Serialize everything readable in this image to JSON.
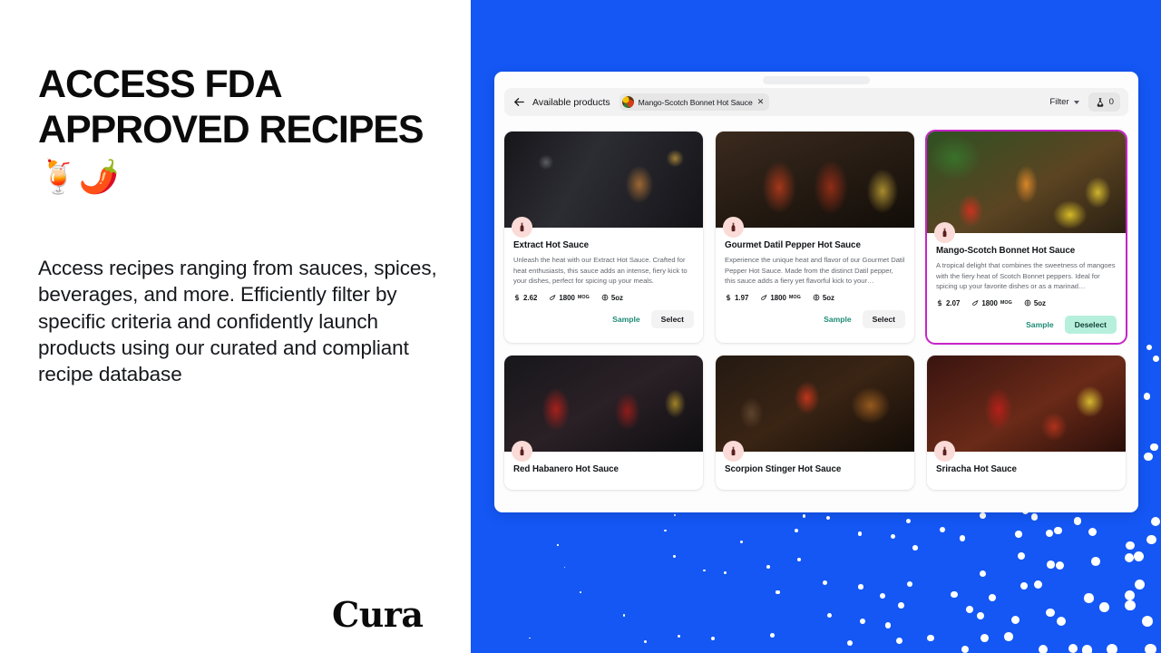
{
  "slide": {
    "headline": "ACCESS FDA APPROVED RECIPES",
    "headline_emojis": "🍹🌶️",
    "subcopy": "Access recipes ranging from sauces, spices, beverages, and more. Efficiently filter by specific criteria and confidently launch products using our curated and compliant recipe database",
    "brand": "Cura",
    "accent_blue": "#1457f5",
    "accent_magenta": "#c724c7",
    "accent_teal": "#1e8b76",
    "badge_pink": "#fadbd7"
  },
  "app": {
    "toolbar": {
      "back_icon": "arrow-left-icon",
      "title": "Available products",
      "chip": {
        "label": "Mango-Scotch Bonnet Hot Sauce",
        "close": "✕",
        "avatar_icon": "product-thumbnail"
      },
      "filter_label": "Filter",
      "count_value": "0",
      "count_icon": "flask-icon"
    },
    "labels": {
      "sample": "Sample",
      "select": "Select",
      "deselect": "Deselect",
      "price_icon": "dollar-icon",
      "heat_icon": "pepper-heat-icon",
      "size_icon": "volume-icon"
    },
    "products": [
      {
        "title": "Extract Hot Sauce",
        "description": "Unleash the heat with our Extract Hot Sauce. Crafted for heat enthusiasts, this sauce adds an intense, fiery kick to your dishes, perfect for spicing up your meals.",
        "price": "2.62",
        "heat": "1800",
        "heat_unit": "MOG",
        "size": "5oz",
        "action": "Select",
        "selected": false,
        "photo": "photo-extract"
      },
      {
        "title": "Gourmet Datil Pepper Hot Sauce",
        "description": "Experience the unique heat and flavor of our Gourmet Datil Pepper Hot Sauce. Made from the distinct Datil pepper, this sauce adds a fiery yet flavorful kick to your…",
        "price": "1.97",
        "heat": "1800",
        "heat_unit": "MOG",
        "size": "5oz",
        "action": "Select",
        "selected": false,
        "photo": "photo-datil"
      },
      {
        "title": "Mango-Scotch Bonnet Hot Sauce",
        "description": "A tropical delight that combines the sweetness of mangoes with the fiery heat of Scotch Bonnet peppers. Ideal for spicing up your favorite dishes or as a marinad…",
        "price": "2.07",
        "heat": "1800",
        "heat_unit": "MOG",
        "size": "5oz",
        "action": "Deselect",
        "selected": true,
        "photo": "photo-mango"
      },
      {
        "title": "Red Habanero Hot Sauce",
        "photo": "photo-habanero"
      },
      {
        "title": "Scorpion Stinger Hot Sauce",
        "photo": "photo-scorpion"
      },
      {
        "title": "Sriracha Hot Sauce",
        "photo": "photo-sriracha"
      }
    ]
  }
}
